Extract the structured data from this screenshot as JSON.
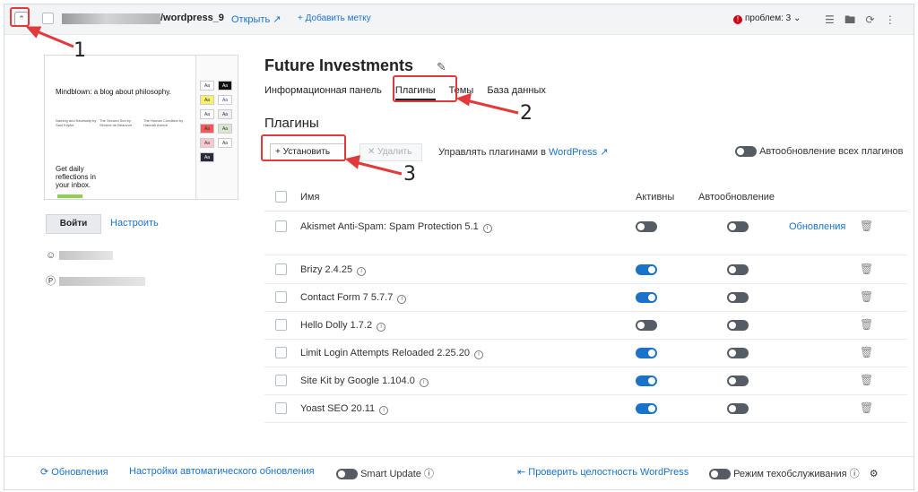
{
  "header": {
    "collapse_icon": "chevron-up-icon",
    "domain_suffix": "/wordpress_9",
    "open_label": "Открыть",
    "add_tag_label": "+ Добавить метку",
    "problems_label": "проблем: 3",
    "colors": {
      "problem": "#d0021b",
      "accent": "#1a73c9"
    }
  },
  "thumbnail": {
    "headline": "Mindblown: a blog about philosophy.",
    "columns": [
      "Naming and Necessity by Saul Kripke",
      "The Second Sex by Simone de Beauvoir",
      "The Human Condition by Hannah Arendt"
    ],
    "cta": "Get daily reflections in your inbox."
  },
  "sidebar": {
    "login_label": "Войти",
    "configure_label": "Настроить"
  },
  "site": {
    "title": "Future Investments",
    "tabs": [
      {
        "label": "Информационная панель",
        "active": false
      },
      {
        "label": "Плагины",
        "active": true
      },
      {
        "label": "Темы",
        "active": false
      },
      {
        "label": "База данных",
        "active": false
      }
    ],
    "section_title": "Плагины"
  },
  "toolbar": {
    "install_label": "+ Установить",
    "delete_label": "✕ Удалить",
    "manage_prefix": "Управлять плагинами в ",
    "manage_link": "WordPress",
    "autoupdate_all_label": "Автообновление всех плагинов"
  },
  "table": {
    "headers": {
      "name": "Имя",
      "active": "Активны",
      "autoupdate": "Автообновление"
    },
    "rows": [
      {
        "name": "Akismet Anti-Spam: Spam Protection 5.1",
        "active": false,
        "auto": false,
        "update": "Обновления"
      },
      {
        "name": "Brizy 2.4.25",
        "active": true,
        "auto": false,
        "update": ""
      },
      {
        "name": "Contact Form 7 5.7.7",
        "active": true,
        "auto": false,
        "update": ""
      },
      {
        "name": "Hello Dolly 1.7.2",
        "active": false,
        "auto": false,
        "update": ""
      },
      {
        "name": "Limit Login Attempts Reloaded 2.25.20",
        "active": true,
        "auto": false,
        "update": ""
      },
      {
        "name": "Site Kit by Google 1.104.0",
        "active": true,
        "auto": false,
        "update": ""
      },
      {
        "name": "Yoast SEO 20.11",
        "active": true,
        "auto": false,
        "update": ""
      }
    ]
  },
  "footer": {
    "updates_label": "Обновления",
    "auto_settings_label": "Настройки автоматического обновления",
    "smart_update_label": "Smart Update",
    "integrity_label": "Проверить целостность WordPress",
    "maintenance_label": "Режим техобслуживания"
  },
  "annotations": [
    "1",
    "2",
    "3"
  ]
}
